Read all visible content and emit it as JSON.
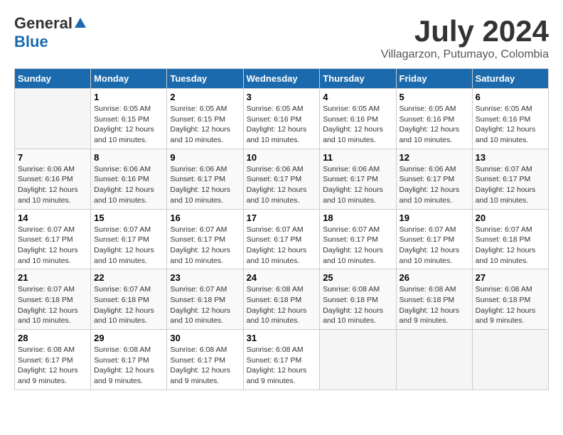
{
  "header": {
    "logo_general": "General",
    "logo_blue": "Blue",
    "month_year": "July 2024",
    "location": "Villagarzon, Putumayo, Colombia"
  },
  "days_of_week": [
    "Sunday",
    "Monday",
    "Tuesday",
    "Wednesday",
    "Thursday",
    "Friday",
    "Saturday"
  ],
  "weeks": [
    [
      {
        "day": "",
        "info": ""
      },
      {
        "day": "1",
        "info": "Sunrise: 6:05 AM\nSunset: 6:15 PM\nDaylight: 12 hours\nand 10 minutes."
      },
      {
        "day": "2",
        "info": "Sunrise: 6:05 AM\nSunset: 6:15 PM\nDaylight: 12 hours\nand 10 minutes."
      },
      {
        "day": "3",
        "info": "Sunrise: 6:05 AM\nSunset: 6:16 PM\nDaylight: 12 hours\nand 10 minutes."
      },
      {
        "day": "4",
        "info": "Sunrise: 6:05 AM\nSunset: 6:16 PM\nDaylight: 12 hours\nand 10 minutes."
      },
      {
        "day": "5",
        "info": "Sunrise: 6:05 AM\nSunset: 6:16 PM\nDaylight: 12 hours\nand 10 minutes."
      },
      {
        "day": "6",
        "info": "Sunrise: 6:05 AM\nSunset: 6:16 PM\nDaylight: 12 hours\nand 10 minutes."
      }
    ],
    [
      {
        "day": "7",
        "info": "Sunrise: 6:06 AM\nSunset: 6:16 PM\nDaylight: 12 hours\nand 10 minutes."
      },
      {
        "day": "8",
        "info": "Sunrise: 6:06 AM\nSunset: 6:16 PM\nDaylight: 12 hours\nand 10 minutes."
      },
      {
        "day": "9",
        "info": "Sunrise: 6:06 AM\nSunset: 6:17 PM\nDaylight: 12 hours\nand 10 minutes."
      },
      {
        "day": "10",
        "info": "Sunrise: 6:06 AM\nSunset: 6:17 PM\nDaylight: 12 hours\nand 10 minutes."
      },
      {
        "day": "11",
        "info": "Sunrise: 6:06 AM\nSunset: 6:17 PM\nDaylight: 12 hours\nand 10 minutes."
      },
      {
        "day": "12",
        "info": "Sunrise: 6:06 AM\nSunset: 6:17 PM\nDaylight: 12 hours\nand 10 minutes."
      },
      {
        "day": "13",
        "info": "Sunrise: 6:07 AM\nSunset: 6:17 PM\nDaylight: 12 hours\nand 10 minutes."
      }
    ],
    [
      {
        "day": "14",
        "info": "Sunrise: 6:07 AM\nSunset: 6:17 PM\nDaylight: 12 hours\nand 10 minutes."
      },
      {
        "day": "15",
        "info": "Sunrise: 6:07 AM\nSunset: 6:17 PM\nDaylight: 12 hours\nand 10 minutes."
      },
      {
        "day": "16",
        "info": "Sunrise: 6:07 AM\nSunset: 6:17 PM\nDaylight: 12 hours\nand 10 minutes."
      },
      {
        "day": "17",
        "info": "Sunrise: 6:07 AM\nSunset: 6:17 PM\nDaylight: 12 hours\nand 10 minutes."
      },
      {
        "day": "18",
        "info": "Sunrise: 6:07 AM\nSunset: 6:17 PM\nDaylight: 12 hours\nand 10 minutes."
      },
      {
        "day": "19",
        "info": "Sunrise: 6:07 AM\nSunset: 6:17 PM\nDaylight: 12 hours\nand 10 minutes."
      },
      {
        "day": "20",
        "info": "Sunrise: 6:07 AM\nSunset: 6:18 PM\nDaylight: 12 hours\nand 10 minutes."
      }
    ],
    [
      {
        "day": "21",
        "info": "Sunrise: 6:07 AM\nSunset: 6:18 PM\nDaylight: 12 hours\nand 10 minutes."
      },
      {
        "day": "22",
        "info": "Sunrise: 6:07 AM\nSunset: 6:18 PM\nDaylight: 12 hours\nand 10 minutes."
      },
      {
        "day": "23",
        "info": "Sunrise: 6:07 AM\nSunset: 6:18 PM\nDaylight: 12 hours\nand 10 minutes."
      },
      {
        "day": "24",
        "info": "Sunrise: 6:08 AM\nSunset: 6:18 PM\nDaylight: 12 hours\nand 10 minutes."
      },
      {
        "day": "25",
        "info": "Sunrise: 6:08 AM\nSunset: 6:18 PM\nDaylight: 12 hours\nand 10 minutes."
      },
      {
        "day": "26",
        "info": "Sunrise: 6:08 AM\nSunset: 6:18 PM\nDaylight: 12 hours\nand 9 minutes."
      },
      {
        "day": "27",
        "info": "Sunrise: 6:08 AM\nSunset: 6:18 PM\nDaylight: 12 hours\nand 9 minutes."
      }
    ],
    [
      {
        "day": "28",
        "info": "Sunrise: 6:08 AM\nSunset: 6:17 PM\nDaylight: 12 hours\nand 9 minutes."
      },
      {
        "day": "29",
        "info": "Sunrise: 6:08 AM\nSunset: 6:17 PM\nDaylight: 12 hours\nand 9 minutes."
      },
      {
        "day": "30",
        "info": "Sunrise: 6:08 AM\nSunset: 6:17 PM\nDaylight: 12 hours\nand 9 minutes."
      },
      {
        "day": "31",
        "info": "Sunrise: 6:08 AM\nSunset: 6:17 PM\nDaylight: 12 hours\nand 9 minutes."
      },
      {
        "day": "",
        "info": ""
      },
      {
        "day": "",
        "info": ""
      },
      {
        "day": "",
        "info": ""
      }
    ]
  ]
}
